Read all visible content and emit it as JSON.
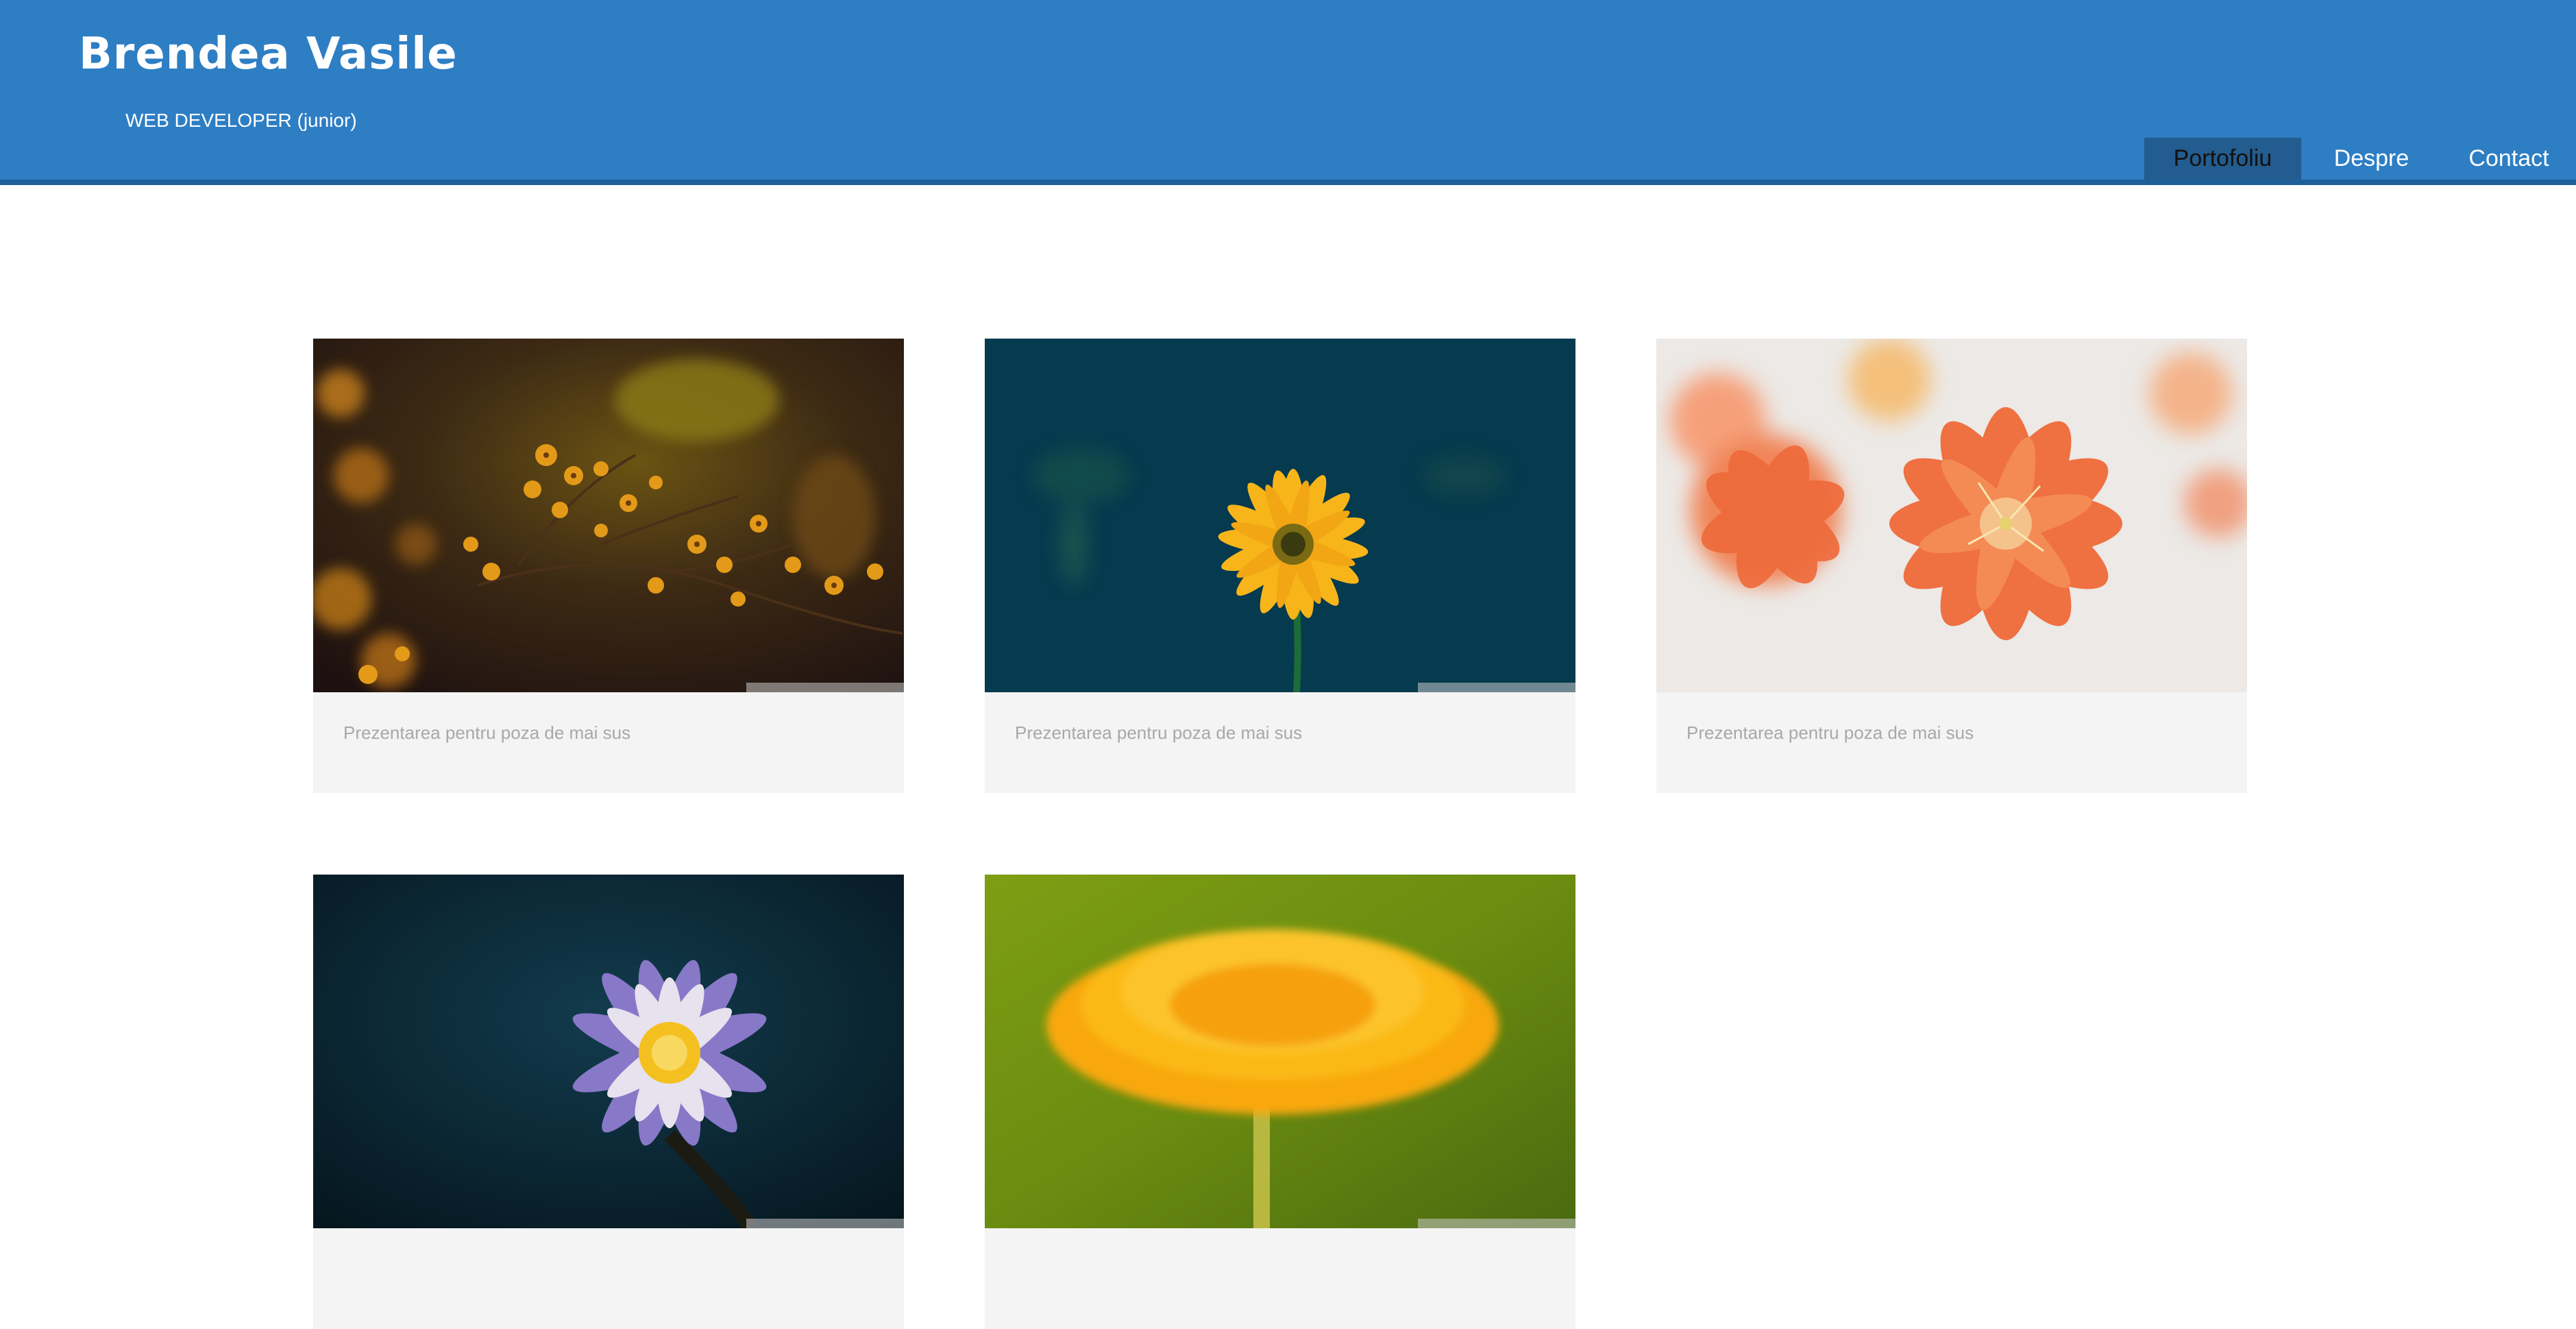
{
  "header": {
    "name": "Brendea Vasile",
    "role": "WEB DEVELOPER (junior)",
    "background_color": "#2e7ec4"
  },
  "nav": {
    "items": [
      {
        "label": "Portofoliu",
        "active": true
      },
      {
        "label": "Despre",
        "active": false
      },
      {
        "label": "Contact",
        "active": false
      }
    ]
  },
  "gallery": {
    "cards": [
      {
        "image": "orange-wildflowers-photo",
        "caption": "Prezentarea pentru poza de mai sus"
      },
      {
        "image": "yellow-daisy-photo",
        "caption": "Prezentarea pentru poza de mai sus"
      },
      {
        "image": "orange-lewisia-photo",
        "caption": "Prezentarea pentru poza de mai sus"
      },
      {
        "image": "purple-water-lily-photo",
        "caption": ""
      },
      {
        "image": "yellow-gerbera-photo",
        "caption": ""
      }
    ]
  }
}
